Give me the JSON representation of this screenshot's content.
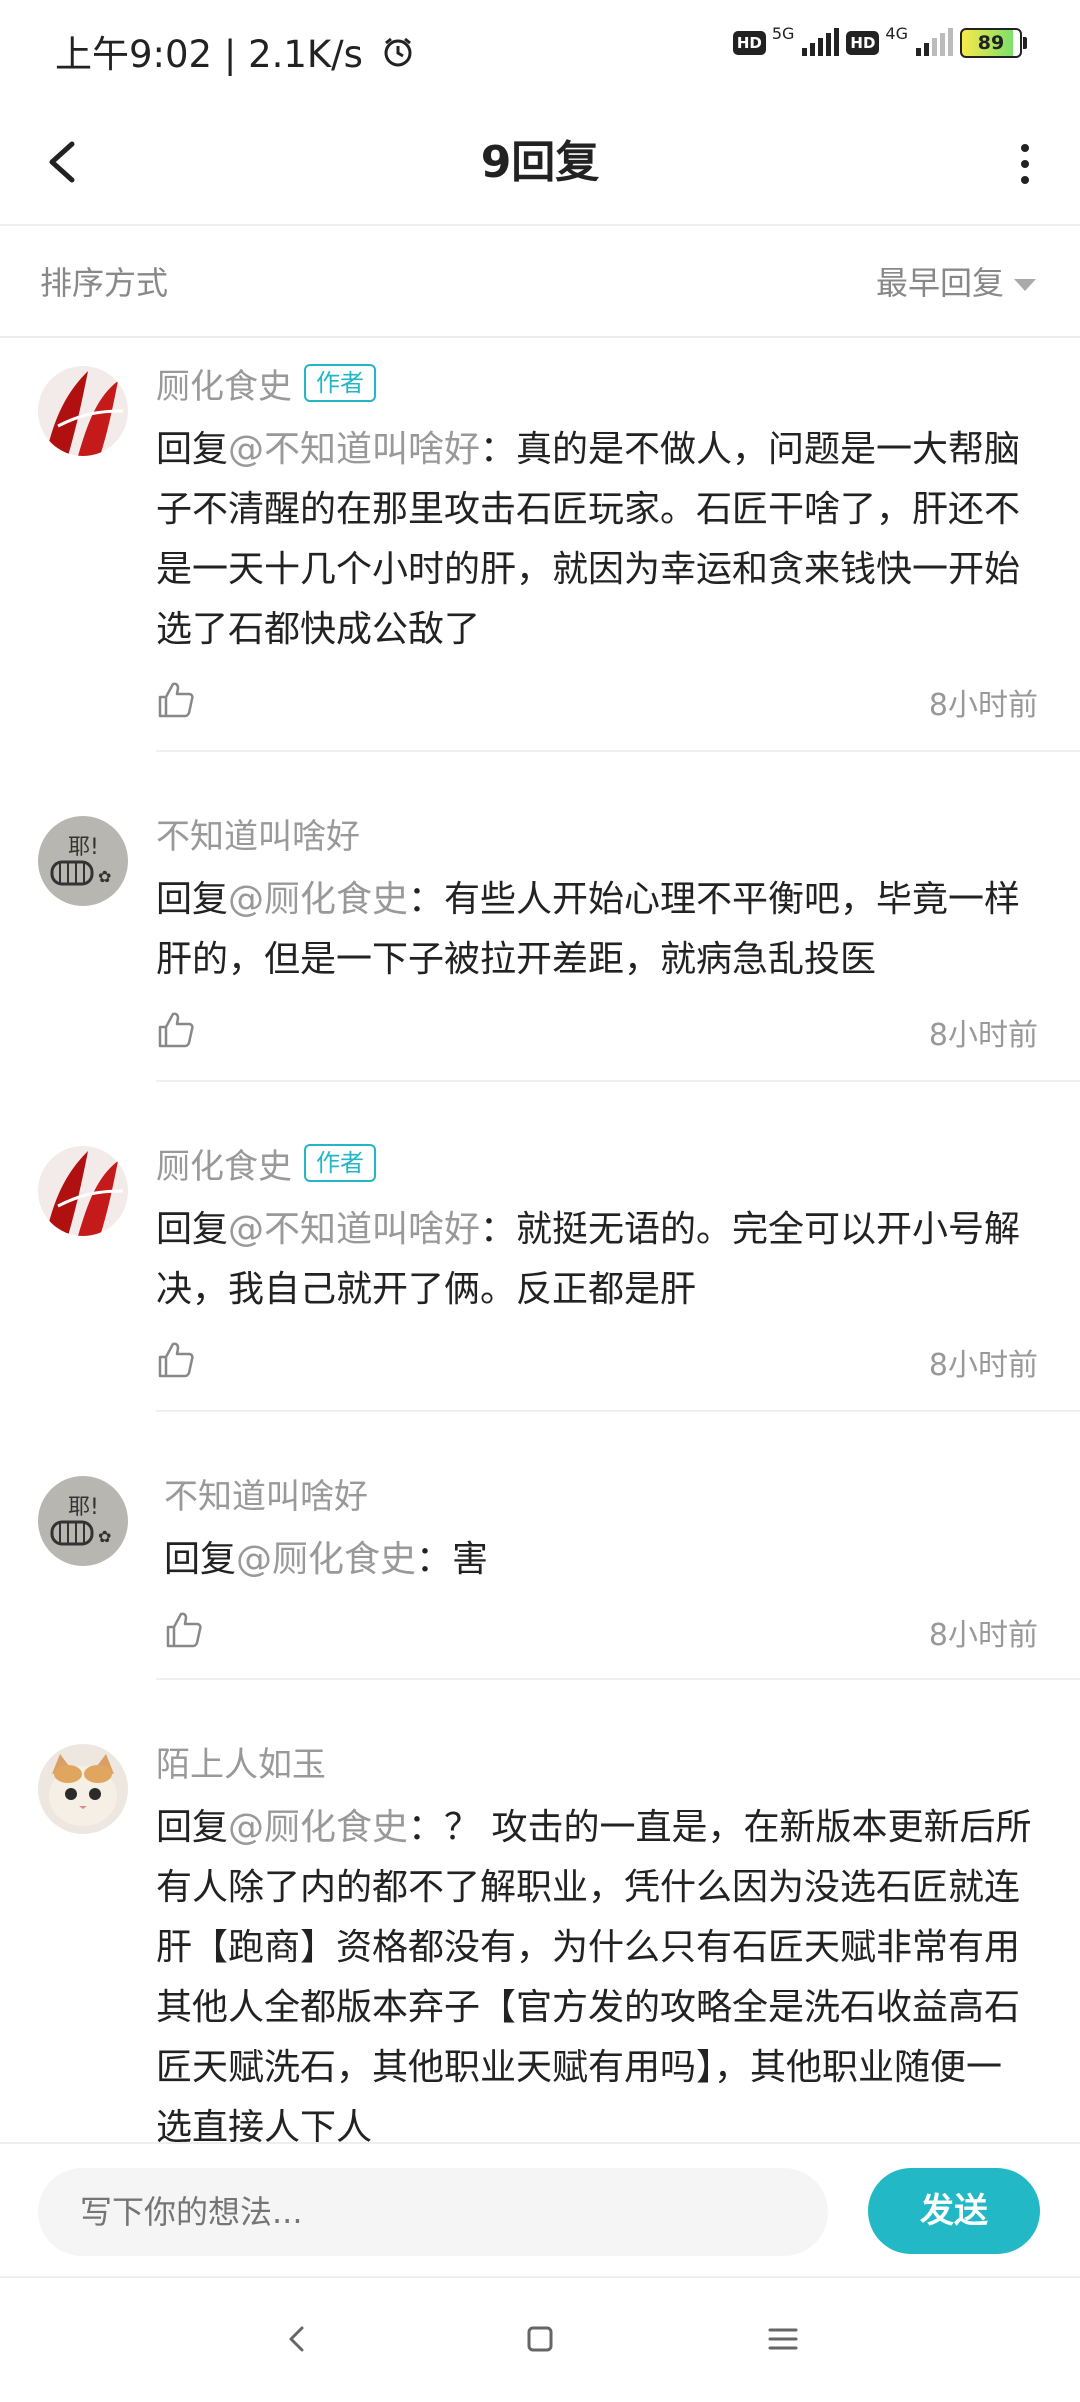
{
  "status_bar": {
    "time": "上午9:02 | 2.1K/s",
    "hd1": "HD",
    "net1": "5G",
    "hd2": "HD",
    "net2": "4G",
    "battery": "89"
  },
  "header": {
    "title": "9回复"
  },
  "sort": {
    "label": "排序方式",
    "value": "最早回复"
  },
  "comments": [
    {
      "name": "厕化食史",
      "badge": "作者",
      "prefix": "回复",
      "mention": "@不知道叫啥好",
      "text": "：真的是不做人，问题是一大帮脑子不清醒的在那里攻击石匠玩家。石匠干啥了，肝还不是一天十几个小时的肝，就因为幸运和贪来钱快一开始选了石都快成公敌了",
      "time": "8小时前"
    },
    {
      "name": "不知道叫啥好",
      "badge": "",
      "prefix": "回复",
      "mention": "@厕化食史",
      "text": "：有些人开始心理不平衡吧，毕竟一样肝的，但是一下子被拉开差距，就病急乱投医",
      "time": "8小时前"
    },
    {
      "name": "厕化食史",
      "badge": "作者",
      "prefix": "回复",
      "mention": "@不知道叫啥好",
      "text": "：就挺无语的。完全可以开小号解决，我自己就开了俩。反正都是肝",
      "time": "8小时前"
    },
    {
      "name": "不知道叫啥好",
      "badge": "",
      "prefix": "回复",
      "mention": "@厕化食史",
      "text": "：害",
      "time": "8小时前"
    },
    {
      "name": "陌上人如玉",
      "badge": "",
      "prefix": "回复",
      "mention": "@厕化食史",
      "text": "：？ 攻击的一直是，在新版本更新后所有人除了内的都不了解职业，凭什么因为没选石匠就连肝【跑商】资格都没有，为什么只有石匠天赋非常有用其他人全都版本弃子【官方发的攻略全是洗石收益高石匠天赋洗石，其他职业天赋有用吗】，其他职业随便一选直接人下人",
      "time": ""
    }
  ],
  "input": {
    "placeholder": "写下你的想法...",
    "send_label": "发送"
  },
  "icons": {
    "back": "chevron-left-icon",
    "more": "more-vertical-icon",
    "like": "thumbs-up-icon",
    "nav_back": "nav-back-icon",
    "nav_home": "nav-home-icon",
    "nav_menu": "nav-menu-icon"
  },
  "colors": {
    "accent": "#22b8c5",
    "muted_text": "#999999"
  }
}
